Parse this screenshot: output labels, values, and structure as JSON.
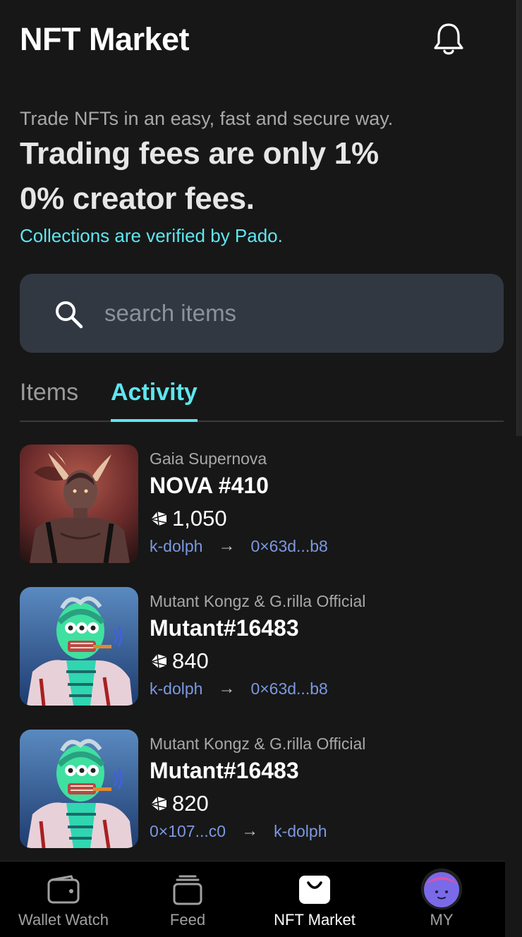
{
  "header": {
    "title": "NFT Market"
  },
  "intro": {
    "tagline": "Trade NFTs in an easy, fast and secure way.",
    "headline_1": "Trading fees are only 1%",
    "headline_2": "0% creator fees.",
    "verified": "Collections are verified by Pado."
  },
  "search": {
    "placeholder": "search items",
    "value": ""
  },
  "tabs": [
    {
      "label": "Items",
      "active": false
    },
    {
      "label": "Activity",
      "active": true
    }
  ],
  "activity": [
    {
      "collection": "Gaia Supernova",
      "name": "NOVA #410",
      "price": "1,050",
      "from": "k-dolph",
      "to": "0×63d...b8",
      "image": "nova-portrait"
    },
    {
      "collection": "Mutant Kongz & G.rilla Official",
      "name": "Mutant#16483",
      "price": "840",
      "from": "k-dolph",
      "to": "0×63d...b8",
      "image": "mutant-gorilla"
    },
    {
      "collection": "Mutant Kongz & G.rilla Official",
      "name": "Mutant#16483",
      "price": "820",
      "from": "0×107...c0",
      "to": "k-dolph",
      "image": "mutant-gorilla"
    }
  ],
  "nav": [
    {
      "label": "Wallet Watch",
      "icon": "wallet-icon",
      "active": false
    },
    {
      "label": "Feed",
      "icon": "feed-icon",
      "active": false
    },
    {
      "label": "NFT Market",
      "icon": "shopping-bag-icon",
      "active": true
    },
    {
      "label": "MY",
      "icon": "avatar",
      "active": false
    }
  ],
  "colors": {
    "accent": "#5ee6f0",
    "link": "#7b98e0",
    "background": "#171717",
    "search_bg": "#323842"
  }
}
